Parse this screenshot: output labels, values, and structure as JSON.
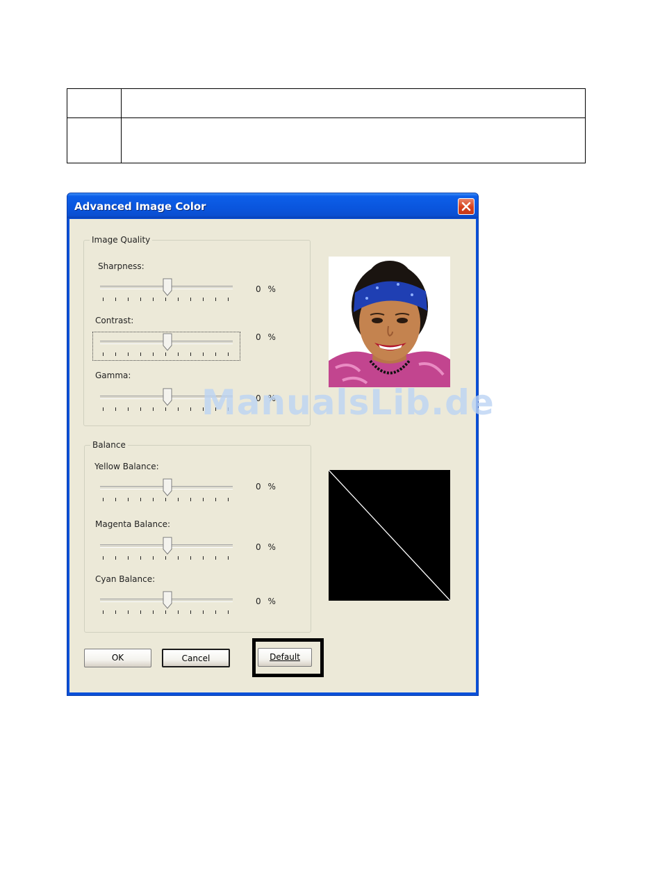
{
  "dialog": {
    "title": "Advanced Image Color"
  },
  "image_quality": {
    "legend": "Image Quality",
    "sliders": [
      {
        "label": "Sharpness:",
        "value": "0 %",
        "level": 0
      },
      {
        "label": "Contrast:",
        "value": "0 %",
        "level": 0
      },
      {
        "label": "Gamma:",
        "value": "0 %",
        "level": 0
      }
    ]
  },
  "balance": {
    "legend": "Balance",
    "sliders": [
      {
        "label": "Yellow Balance:",
        "value": "0 %",
        "level": 0
      },
      {
        "label": "Magenta Balance:",
        "value": "0 %",
        "level": 0
      },
      {
        "label": "Cyan Balance:",
        "value": "0 %",
        "level": 0
      }
    ]
  },
  "buttons": {
    "ok": "OK",
    "cancel": "Cancel",
    "default": "Default"
  },
  "watermark": "ManualsLib.de",
  "colors": {
    "titlebar": "#0a55dd",
    "client": "#ece9d8",
    "close": "#d6411c"
  },
  "icons": [
    "close-icon"
  ]
}
